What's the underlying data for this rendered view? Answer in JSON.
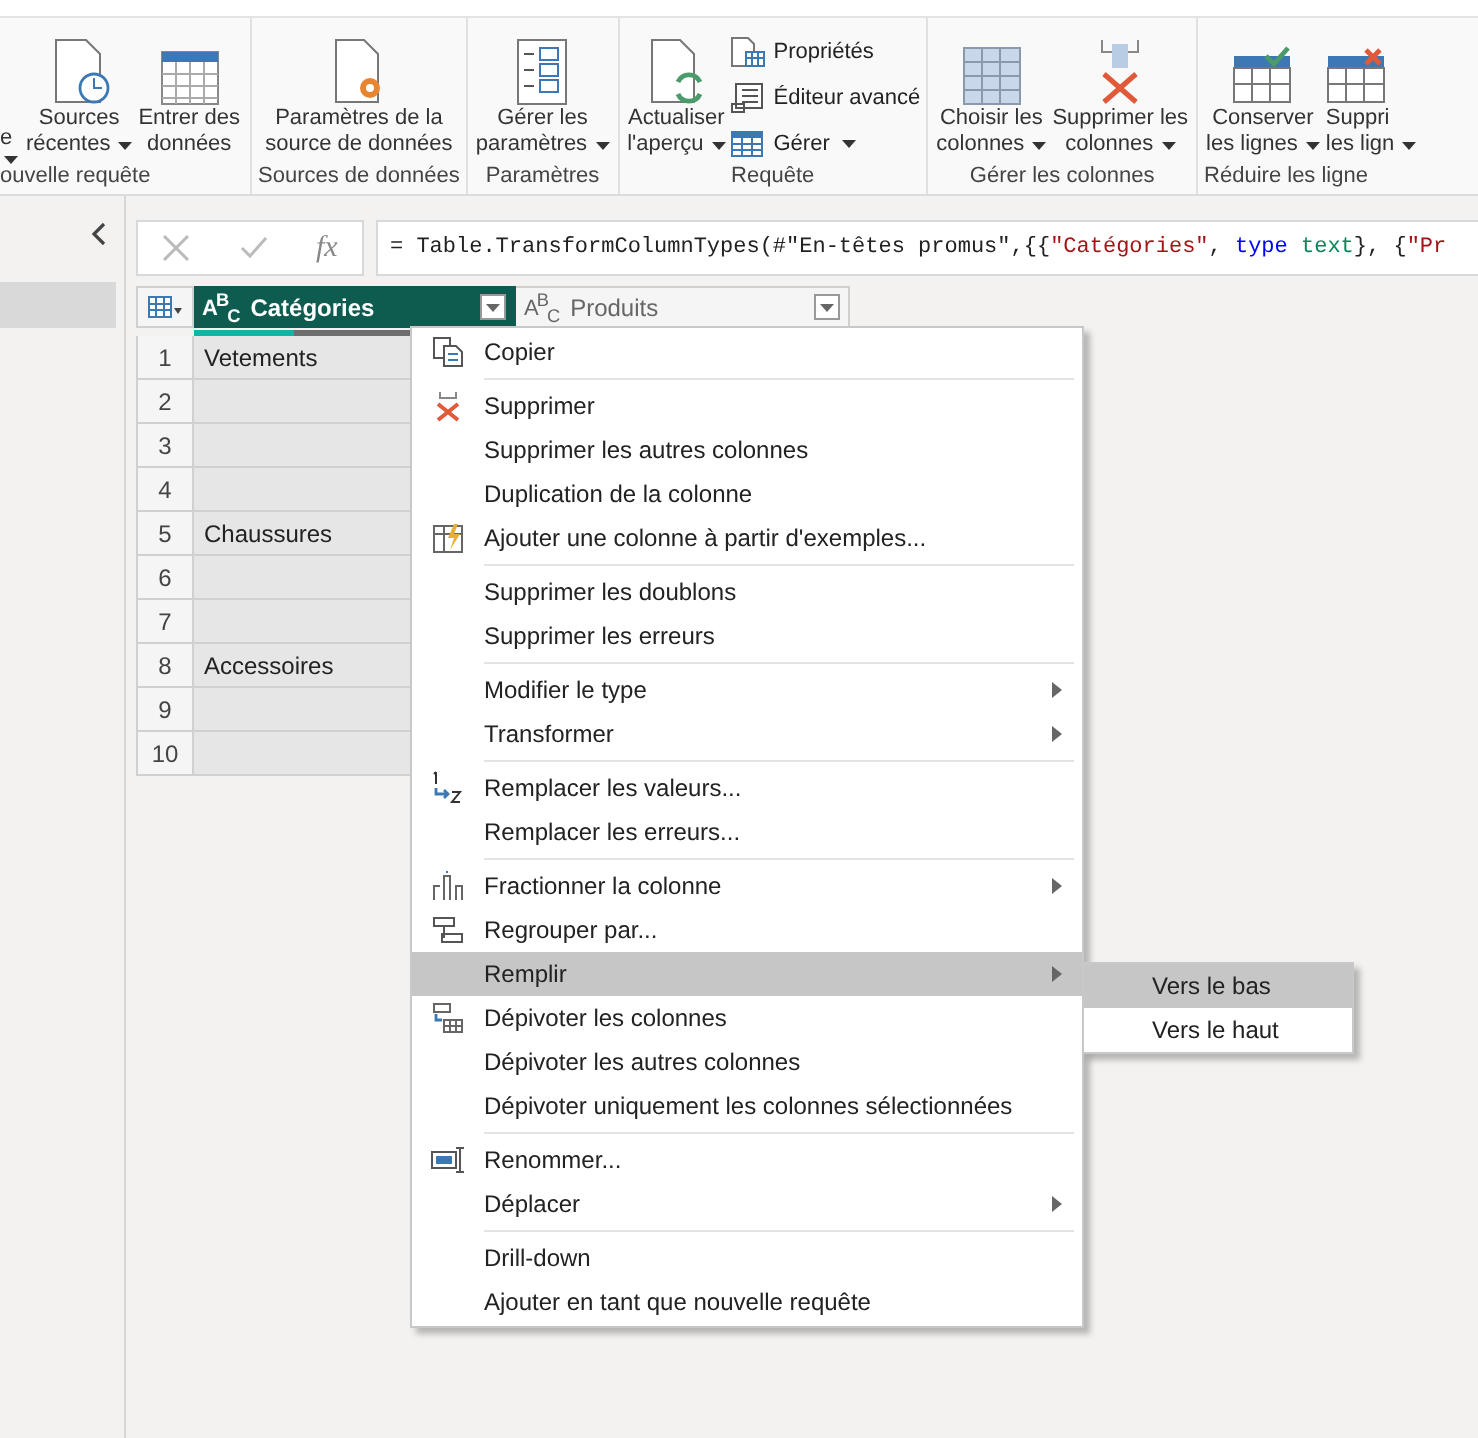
{
  "ribbon": {
    "groups": [
      {
        "label": "ouvelle requête",
        "buttons": [
          {
            "lines": [
              "e"
            ],
            "dropdown": true
          },
          {
            "lines": [
              "Sources",
              "récentes"
            ],
            "dropdown": true
          },
          {
            "lines": [
              "Entrer des",
              "données"
            ],
            "dropdown": false
          }
        ]
      },
      {
        "label": "Sources de données",
        "buttons": [
          {
            "lines": [
              "Paramètres de la",
              "source de données"
            ],
            "dropdown": false
          }
        ]
      },
      {
        "label": "Paramètres",
        "buttons": [
          {
            "lines": [
              "Gérer les",
              "paramètres"
            ],
            "dropdown": true
          }
        ]
      },
      {
        "label": "Requête",
        "buttons": [
          {
            "lines": [
              "Actualiser",
              "l'aperçu"
            ],
            "dropdown": true
          }
        ],
        "small_buttons": [
          {
            "label": "Propriétés",
            "dropdown": false
          },
          {
            "label": "Éditeur avancé",
            "dropdown": false
          },
          {
            "label": "Gérer",
            "dropdown": true
          }
        ]
      },
      {
        "label": "Gérer les colonnes",
        "buttons": [
          {
            "lines": [
              "Choisir les",
              "colonnes"
            ],
            "dropdown": true
          },
          {
            "lines": [
              "Supprimer les",
              "colonnes"
            ],
            "dropdown": true
          }
        ]
      },
      {
        "label": "Réduire les ligne",
        "buttons": [
          {
            "lines": [
              "Conserver",
              "les lignes"
            ],
            "dropdown": true
          },
          {
            "lines": [
              "Suppri",
              "les lign"
            ],
            "dropdown": true
          }
        ]
      }
    ]
  },
  "queries": [
    {
      "selected": true
    }
  ],
  "formula": {
    "fx": "fx",
    "segments": [
      {
        "text": "= Table.TransformColumnTypes(#\"En-têtes promus\",{{",
        "kind": "plain"
      },
      {
        "text": "\"Catégories\"",
        "kind": "string"
      },
      {
        "text": ", ",
        "kind": "plain"
      },
      {
        "text": "type",
        "kind": "keyword"
      },
      {
        "text": " text",
        "kind": "type"
      },
      {
        "text": "}, {",
        "kind": "plain"
      },
      {
        "text": "\"Pr",
        "kind": "string"
      }
    ]
  },
  "table": {
    "columns": [
      {
        "type_label": "A$^{B}$$_{C}$",
        "name": "Catégories",
        "selected": true,
        "level": 0.31
      },
      {
        "type_label": "A$^{B}$$_{C}$",
        "name": "Produits",
        "selected": false
      }
    ],
    "rows": [
      {
        "num": "1",
        "cells": [
          "Vetements"
        ]
      },
      {
        "num": "2",
        "cells": []
      },
      {
        "num": "3",
        "cells": []
      },
      {
        "num": "4",
        "cells": []
      },
      {
        "num": "5",
        "cells": [
          "Chaussures"
        ]
      },
      {
        "num": "6",
        "cells": []
      },
      {
        "num": "7",
        "cells": []
      },
      {
        "num": "8",
        "cells": [
          "Accessoires"
        ]
      },
      {
        "num": "9",
        "cells": []
      },
      {
        "num": "10",
        "cells": []
      }
    ]
  },
  "context_menu": {
    "groups": [
      [
        {
          "label": "Copier",
          "kind": "copy",
          "selected": false
        }
      ],
      [
        {
          "label": "Supprimer",
          "kind": "delete",
          "selected": false
        },
        {
          "label": "Supprimer les autres colonnes",
          "selected": false
        },
        {
          "label": "Duplication de la colonne",
          "selected": false
        },
        {
          "label": "Ajouter une colonne à partir d'exemples...",
          "kind": "examples",
          "selected": false
        }
      ],
      [
        {
          "label": "Supprimer les doublons",
          "selected": false
        },
        {
          "label": "Supprimer les erreurs",
          "selected": false
        }
      ],
      [
        {
          "label": "Modifier le type",
          "submenu": true,
          "selected": false
        },
        {
          "label": "Transformer",
          "submenu": true,
          "selected": false
        }
      ],
      [
        {
          "label": "Remplacer les valeurs...",
          "kind": "replace",
          "selected": false
        },
        {
          "label": "Remplacer les erreurs...",
          "selected": false
        }
      ],
      [
        {
          "label": "Fractionner la colonne",
          "kind": "split",
          "submenu": true,
          "selected": false
        },
        {
          "label": "Regrouper par...",
          "kind": "group",
          "selected": false
        },
        {
          "label": "Remplir",
          "submenu": true,
          "selected": true,
          "children": [
            {
              "label": "Vers le bas",
              "selected": true
            },
            {
              "label": "Vers le haut",
              "selected": false
            }
          ]
        },
        {
          "label": "Dépivoter les colonnes",
          "kind": "unpivot",
          "selected": false
        },
        {
          "label": "Dépivoter les autres colonnes",
          "selected": false
        },
        {
          "label": "Dépivoter uniquement les colonnes sélectionnées",
          "selected": false
        }
      ],
      [
        {
          "label": "Renommer...",
          "kind": "rename",
          "selected": false
        },
        {
          "label": "Déplacer",
          "submenu": true,
          "selected": false
        }
      ],
      [
        {
          "label": "Drill-down",
          "selected": false
        },
        {
          "label": "Ajouter en tant que nouvelle requête",
          "selected": false
        }
      ]
    ]
  }
}
